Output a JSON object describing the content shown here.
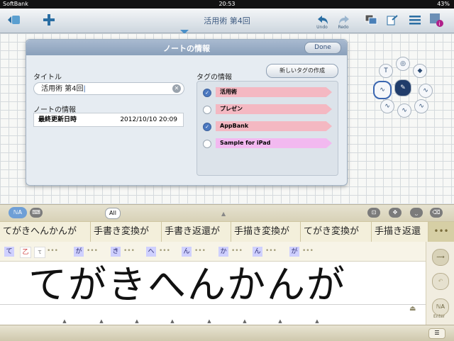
{
  "status": {
    "carrier": "SoftBank",
    "time": "20:53",
    "battery": "43%"
  },
  "nav": {
    "title": "活用術 第4回",
    "undo_label": "Undo",
    "redo_label": "Redo"
  },
  "dialog": {
    "title": "ノートの情報",
    "done_label": "Done",
    "title_label": "タイトル",
    "title_value": "活用術 第4回",
    "note_info_label": "ノートの情報",
    "last_updated_key": "最終更新日時",
    "last_updated_value": "2012/10/10 20:09",
    "tag_info_label": "タグの情報",
    "new_tag_label": "新しいタグの作成",
    "tags": [
      {
        "name": "活用術",
        "checked": true,
        "color": "#f4b8c2"
      },
      {
        "name": "プレゼン",
        "checked": false,
        "color": "#f4b8c2"
      },
      {
        "name": "AppBank",
        "checked": true,
        "color": "#f4b8c2"
      },
      {
        "name": "Sample for iPad",
        "checked": false,
        "color": "#f2b9f0"
      }
    ]
  },
  "hwbar": {
    "all_label": "All"
  },
  "candidates": [
    "てがきへんかんが",
    "手書き変換が",
    "手書き返還が",
    "手描き変換が",
    "てがき変換が",
    "手描き返還"
  ],
  "candidate_more": "•••",
  "chars": [
    "て",
    "乙",
    "τ",
    "が",
    "き",
    "へ",
    "ん",
    "か",
    "ん",
    "が"
  ],
  "handwriting": "てがきへんかんが",
  "enter_label": "Enter",
  "colors": {
    "accent": "#2a6ea3",
    "dialog_head": "#8aa0bb",
    "tag_pink": "#f4b8c2"
  }
}
